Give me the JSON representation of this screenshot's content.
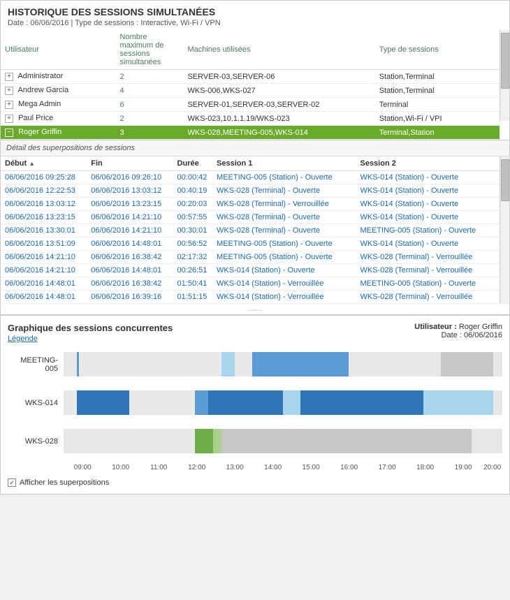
{
  "header": {
    "title": "HISTORIQUE DES SESSIONS SIMULTANÉES",
    "subtitle": "Date : 06/06/2016 | Type de sessions : Interactive, Wi-Fi / VPN"
  },
  "top_table": {
    "columns": [
      "Utilisateur",
      "Nombre maximum de sessions simultanées",
      "Machines utilisées",
      "Type de sessions"
    ],
    "rows": [
      {
        "user": "Administrator",
        "max_sessions": "2",
        "machines": "SERVER-03,SERVER-06",
        "type": "Station,Terminal",
        "selected": false,
        "expanded": false
      },
      {
        "user": "Andrew Garcia",
        "max_sessions": "4",
        "machines": "WKS-006,WKS-027",
        "type": "Station,Terminal",
        "selected": false,
        "expanded": false
      },
      {
        "user": "Mega Admin",
        "max_sessions": "6",
        "machines": "SERVER-01,SERVER-03,SERVER-02",
        "type": "Terminal",
        "selected": false,
        "expanded": false
      },
      {
        "user": "Paul Price",
        "max_sessions": "2",
        "machines": "WKS-023,10.1.1.19/WKS-023",
        "type": "Station,Wi-Fi / VPI",
        "selected": false,
        "expanded": false
      },
      {
        "user": "Roger Griffin",
        "max_sessions": "3",
        "machines": "WKS-028,MEETING-005,WKS-014",
        "type": "Terminal,Station",
        "selected": true,
        "expanded": true
      }
    ]
  },
  "detail_section": {
    "label": "Détail des superpositions de sessions",
    "columns": [
      "Début",
      "Fin",
      "Durée",
      "Session 1",
      "Session 2"
    ],
    "rows": [
      {
        "debut": "06/06/2016 09:25:28",
        "fin": "06/06/2016 09:26:10",
        "duree": "00:00:42",
        "session1": "MEETING-005 (Station) - Ouverte",
        "session2": "WKS-014 (Station) - Ouverte"
      },
      {
        "debut": "06/06/2016 12:22:53",
        "fin": "06/06/2016 13:03:12",
        "duree": "00:40:19",
        "session1": "WKS-028 (Terminal) - Ouverte",
        "session2": "WKS-014 (Station) - Ouverte"
      },
      {
        "debut": "06/06/2016 13:03:12",
        "fin": "06/06/2016 13:23:15",
        "duree": "00:20:03",
        "session1": "WKS-028 (Terminal) - Verrouillée",
        "session2": "WKS-014 (Station) - Ouverte"
      },
      {
        "debut": "06/06/2016 13:23:15",
        "fin": "06/06/2016 14:21:10",
        "duree": "00:57:55",
        "session1": "WKS-028 (Terminal) - Ouverte",
        "session2": "WKS-014 (Station) - Ouverte"
      },
      {
        "debut": "06/06/2016 13:30:01",
        "fin": "06/06/2016 14:21:10",
        "duree": "00:30:01",
        "session1": "WKS-028 (Terminal) - Ouverte",
        "session2": "MEETING-005 (Station) - Ouverte"
      },
      {
        "debut": "06/06/2016 13:51:09",
        "fin": "06/06/2016 14:48:01",
        "duree": "00:56:52",
        "session1": "MEETING-005 (Station) - Ouverte",
        "session2": "WKS-014 (Station) - Ouverte"
      },
      {
        "debut": "06/06/2016 14:21:10",
        "fin": "06/06/2016 16:38:42",
        "duree": "02:17:32",
        "session1": "MEETING-005 (Station) - Ouverte",
        "session2": "WKS-028 (Terminal) - Verrouillée"
      },
      {
        "debut": "06/06/2016 14:21:10",
        "fin": "06/06/2016 14:48:01",
        "duree": "00:26:51",
        "session1": "WKS-014 (Station) - Ouverte",
        "session2": "WKS-028 (Terminal) - Verrouillée"
      },
      {
        "debut": "06/06/2016 14:48:01",
        "fin": "06/06/2016 16:38:42",
        "duree": "01:50:41",
        "session1": "WKS-014 (Station) - Verrouillée",
        "session2": "MEETING-005 (Station) - Ouverte"
      },
      {
        "debut": "06/06/2016 14:48:01",
        "fin": "06/06/2016 16:39:16",
        "duree": "01:51:15",
        "session1": "WKS-014 (Station) - Verrouillée",
        "session2": "WKS-028 (Terminal) - Verrouillée"
      }
    ]
  },
  "chart": {
    "title": "Graphique des sessions concurrentes",
    "legend_label": "Légende",
    "user_label": "Utilisateur :",
    "user_value": "Roger Griffin",
    "date_label": "Date :",
    "date_value": "06/06/2016",
    "rows": [
      {
        "label": "MEETING-005"
      },
      {
        "label": "WKS-014"
      },
      {
        "label": "WKS-028"
      }
    ],
    "x_labels": [
      "09:00",
      "10:00",
      "11:00",
      "12:00",
      "13:00",
      "14:00",
      "15:00",
      "16:00",
      "17:00",
      "18:00",
      "19:00",
      "20:00"
    ],
    "show_overlaps_label": "Afficher les superpositions"
  }
}
